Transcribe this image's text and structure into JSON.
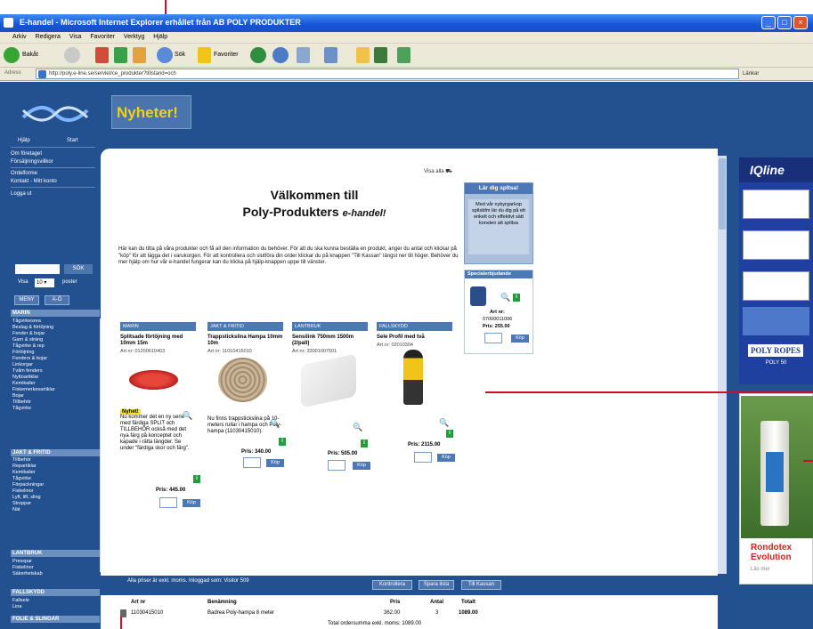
{
  "window": {
    "title": "E-handel - Microsoft Internet Explorer erhållet från AB POLY PRODUKTER",
    "minimize": "_",
    "maximize": "□",
    "close": "×"
  },
  "menu": [
    "Arkiv",
    "Redigera",
    "Visa",
    "Favoriter",
    "Verktyg",
    "Hjälp"
  ],
  "toolbar": {
    "back": "Bakåt",
    "search": "Sök",
    "favorites": "Favoriter"
  },
  "address": {
    "label": "Adress",
    "url": "http://poly.e-line.se/servlet/ce_produkter?tillstand=och",
    "go": "Länkar"
  },
  "banner": {
    "news": "Nyheter!"
  },
  "leftnav": {
    "top_links": [
      "Hjälp",
      "Start"
    ],
    "items": [
      "Om företaget",
      "Försäljningsvillkor",
      "Ordelforme",
      "Kontakt - Mitt konto",
      "Logga ut"
    ],
    "search_button": "SÖK",
    "visa_label": "Visa",
    "visa_value": "10",
    "visa_suffix": "poster",
    "hdr_buttons": [
      "MENY",
      "A-Ö"
    ],
    "categories": [
      {
        "title": "MARIN",
        "items": [
          "Tågvirkesrea",
          "Beslag & förtöjning",
          "Fender & bojar",
          "Garn & sträng",
          "Tågvirke & rep",
          "Förtöjning",
          "Fenders & bojar",
          "Linkorgar",
          "Tvåm fenders",
          "Nyttoartiklar",
          "Kemikalier",
          "Fiskemerkesartiklar",
          "Bojar",
          "Tillbehör",
          "Tågvirke"
        ]
      },
      {
        "title": "JAKT & FRITID",
        "items": [
          "Tillbehör",
          "Repartiklar",
          "Kemikalier",
          "Tågvirke",
          "Förpackningar",
          "Fiskelinor",
          "Lyft, lift, sling",
          "Stroppar",
          "Nät"
        ]
      },
      {
        "title": "LANTBRUK",
        "items": [
          "Presspar",
          "Fiskelinor",
          "Säkerhetskab"
        ]
      },
      {
        "title": "FALLSKYDD",
        "items": [
          "Fallsele",
          "Lina"
        ]
      },
      {
        "title": "FOLIE & SLINGAR",
        "items": []
      }
    ]
  },
  "main": {
    "shop_label": "Visa alla",
    "welcome_line1": "Välkommen till",
    "welcome_line2": "Poly-Produkters",
    "welcome_brand": "e-handel!",
    "intro": "Här kan du titta på våra produkter och få all den information du behöver. För att du ska kunna beställa en produkt, anger du antal och klickar på \"köp\" för att lägga det i varukorgen. För att kontrollera och slutföra din order klickar du på knappen \"Till Kassan\" längst ner till höger. Behöver du mer hjälp om hur vår e-handel fungerar kan du klicka på hjälp-knappen uppe till vänster.",
    "lar_box": {
      "header": "Lär dig spltsa!",
      "text": "Med vår nybyrgarkop spltsbfm lär du dig på ett enkelt och effektivt sätt konsten att splitsa"
    },
    "special": {
      "header": "Specialerbjudande",
      "art_label": "Art nr:",
      "art_no": "07000011006",
      "price_label": "Pris:",
      "price": "255.00",
      "buy": "Köp"
    },
    "products": [
      {
        "category": "MARIN",
        "name": "Splitsade förtöjning med 10mm 15m",
        "art": "Art nr: 01200610403",
        "desc": "Nu kommer det en ny serie med färdiga SPLIT och TILLBEHÖR också med det nya färg på konceptet och kapade i rätta längder. Se under \"färdiga skor och färg\".",
        "tag": "Nyhet!",
        "price": "Pris: 445.00",
        "buy": "Köp"
      },
      {
        "category": "JAKT & FRITID",
        "name": "Trappstickslina Hampa 10mm 10m",
        "art": "Art nr: 11010415010",
        "desc": "Nu finns trappstickslina på 10-meters rullar i hampa och Poly-hampa (11030415010).",
        "price": "Pris: 340.00",
        "buy": "Köp"
      },
      {
        "category": "LANTBRUK",
        "name": "Sensilink 750mm 1500m (2/pall)",
        "art": "Art nr: 33001007501",
        "desc": "",
        "price": "Pris: 505.00",
        "buy": "Köp"
      },
      {
        "category": "FALLSKYDD",
        "name": "Sele Profil med två",
        "art": "Art nr: 02010304",
        "desc": "",
        "price": "Pris: 2115.00",
        "buy": "Köp"
      }
    ]
  },
  "cart": {
    "note": "Alla priser är exkl. moms. Inloggad som: Visitor 509",
    "buttons": [
      "Kontrollera",
      "Spara lista",
      "Till Kassan"
    ],
    "headers": [
      "Art nr",
      "Benämning",
      "Pris",
      "Antal",
      "Totalt"
    ],
    "row": [
      "11030415010",
      "Badrea Poly-hampa 8 meter",
      "362.00",
      "3",
      "1089.00"
    ],
    "total": "Total ordersumma exkl. moms: 1089.00"
  },
  "ads": {
    "ad1_brand": "IQline",
    "ad1_logo": "POLY ROPES",
    "ad1_sub": "POLY 50",
    "ad2_title_1": "Rondotex",
    "ad2_title_2": "Evolution",
    "ad2_more": "Läs mer"
  },
  "colors": {
    "page_blue": "#23508f",
    "accent_yellow": "#f4d012",
    "annotation_red": "#c8102e"
  }
}
